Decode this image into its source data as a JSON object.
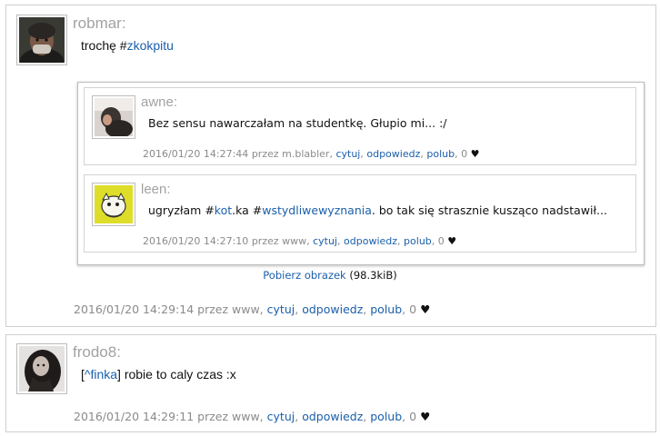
{
  "posts": [
    {
      "author": "robmar:",
      "text_prefix": "trochę #",
      "tag": "zkokpitu",
      "meta": {
        "datetime": "2016/01/20 14:29:14",
        "by_label": "przez www,",
        "quote": "cytuj",
        "reply": "odpowiedz",
        "like": "polub",
        "likes": "0",
        "heart": "♥"
      },
      "attachment": {
        "inner_posts": [
          {
            "author": "awne:",
            "text": "Bez sensu nawarczałam na studentkę. Głupio mi... :/",
            "meta": {
              "datetime": "2016/01/20 14:27:44",
              "by_label": "przez m.blabler,",
              "quote": "cytuj",
              "reply": "odpowiedz",
              "like": "polub",
              "likes": "0",
              "heart": "♥"
            }
          },
          {
            "author": "leen:",
            "text_a": "ugryzłam #",
            "tag1": "kot",
            "text_b": ".ka #",
            "tag2": "wstydliwewyznania",
            "text_c": ". bo tak się strasznie kusząco nadstawił...",
            "meta": {
              "datetime": "2016/01/20 14:27:10",
              "by_label": "przez www,",
              "quote": "cytuj",
              "reply": "odpowiedz",
              "like": "polub",
              "likes": "0",
              "heart": "♥"
            }
          }
        ],
        "download_label": "Pobierz obrazek",
        "size": "(98.3kiB)"
      }
    },
    {
      "author": "frodo8:",
      "bracket_open": "[",
      "mention": "^finka",
      "bracket_close": "]",
      "text": " robie to caly czas :x",
      "meta": {
        "datetime": "2016/01/20 14:29:11",
        "by_label": "przez www,",
        "quote": "cytuj",
        "reply": "odpowiedz",
        "like": "polub",
        "likes": "0",
        "heart": "♥"
      }
    }
  ],
  "colors": {
    "link": "#1b5fab",
    "meta": "#8a8a8a",
    "author": "#a2a2a2"
  }
}
